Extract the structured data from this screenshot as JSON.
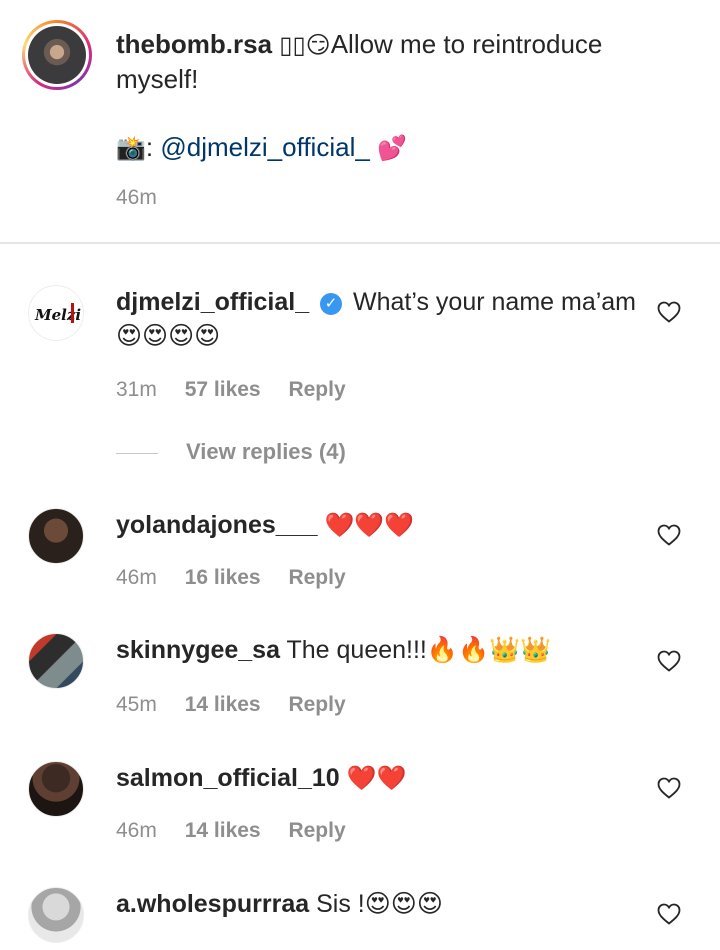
{
  "caption": {
    "username": "thebomb.rsa",
    "lead_glyphs": "▯▯😏",
    "text": "Allow me to reintroduce myself!",
    "credit_icon": "📸",
    "credit_sep": ":",
    "credit_mention": "@djmelzi_official_",
    "credit_emoji": "💕",
    "time": "46m"
  },
  "comments": [
    {
      "username": "djmelzi_official_",
      "verified": true,
      "text": "What’s your name ma’am 😍😍😍😍",
      "time": "31m",
      "likes": "57 likes",
      "reply": "Reply",
      "view_replies": "View replies (4)",
      "avatar_label": "Melzi"
    },
    {
      "username": "yolandajones___",
      "text": "❤️❤️❤️",
      "time": "46m",
      "likes": "16 likes",
      "reply": "Reply"
    },
    {
      "username": "skinnygee_sa",
      "text": "The queen!!!🔥🔥👑👑",
      "time": "45m",
      "likes": "14 likes",
      "reply": "Reply"
    },
    {
      "username": "salmon_official_10",
      "text": "❤️❤️",
      "time": "46m",
      "likes": "14 likes",
      "reply": "Reply"
    },
    {
      "username": "a.wholespurrraa",
      "text": "Sis !😍😍😍",
      "time": "",
      "likes": "",
      "reply": ""
    }
  ],
  "icons": {
    "like": "heart-outline-icon",
    "verified": "verified-badge-icon"
  },
  "colors": {
    "text": "#262626",
    "muted": "#8e8e8e",
    "mention": "#00376b",
    "verified": "#3897f0",
    "heart_red": "#ed4956"
  }
}
